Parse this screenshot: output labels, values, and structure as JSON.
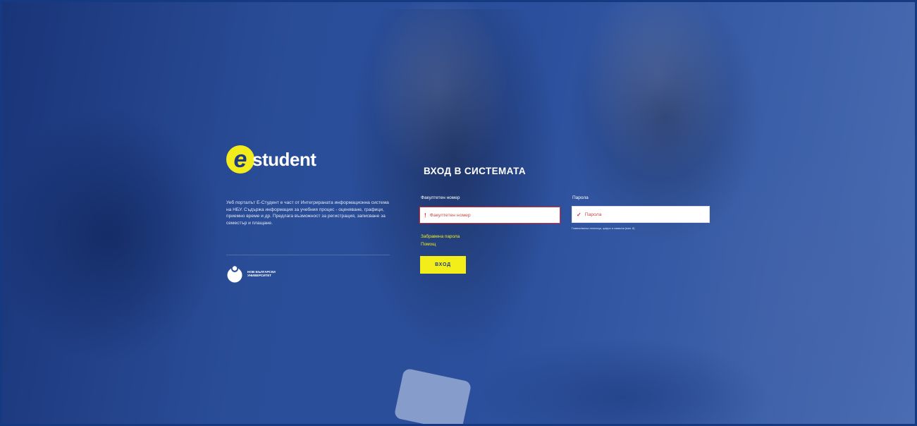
{
  "brand": {
    "logo_letter": "e",
    "logo_text": "student",
    "description": "Уеб порталът Е-Студент е част от Интегрираната информационна система на НБУ. Съдържа информация за учебния процес - оценяване, графици, приемно време и др. Предлага възможност за регистрация, записване за семестър и плащане.",
    "university_name": "НОВ БЪЛГАРСКИ УНИВЕРСИТЕТ"
  },
  "login": {
    "title": "ВХОД В СИСТЕМАТА",
    "faculty_label": "Факултетен номер",
    "faculty_placeholder": "Факултетен номер",
    "faculty_marker": "!",
    "password_label": "Парола",
    "password_placeholder": "Парола",
    "password_marker": "✓",
    "password_hint": "Главна/малка латиница, цифри и символи (мин. 8)",
    "forgot_password": "Забравена парола",
    "help": "Помощ",
    "submit": "ВХОД"
  },
  "colors": {
    "accent": "#f3ee1a",
    "background": "#2b4f9c",
    "error": "#d63030"
  }
}
